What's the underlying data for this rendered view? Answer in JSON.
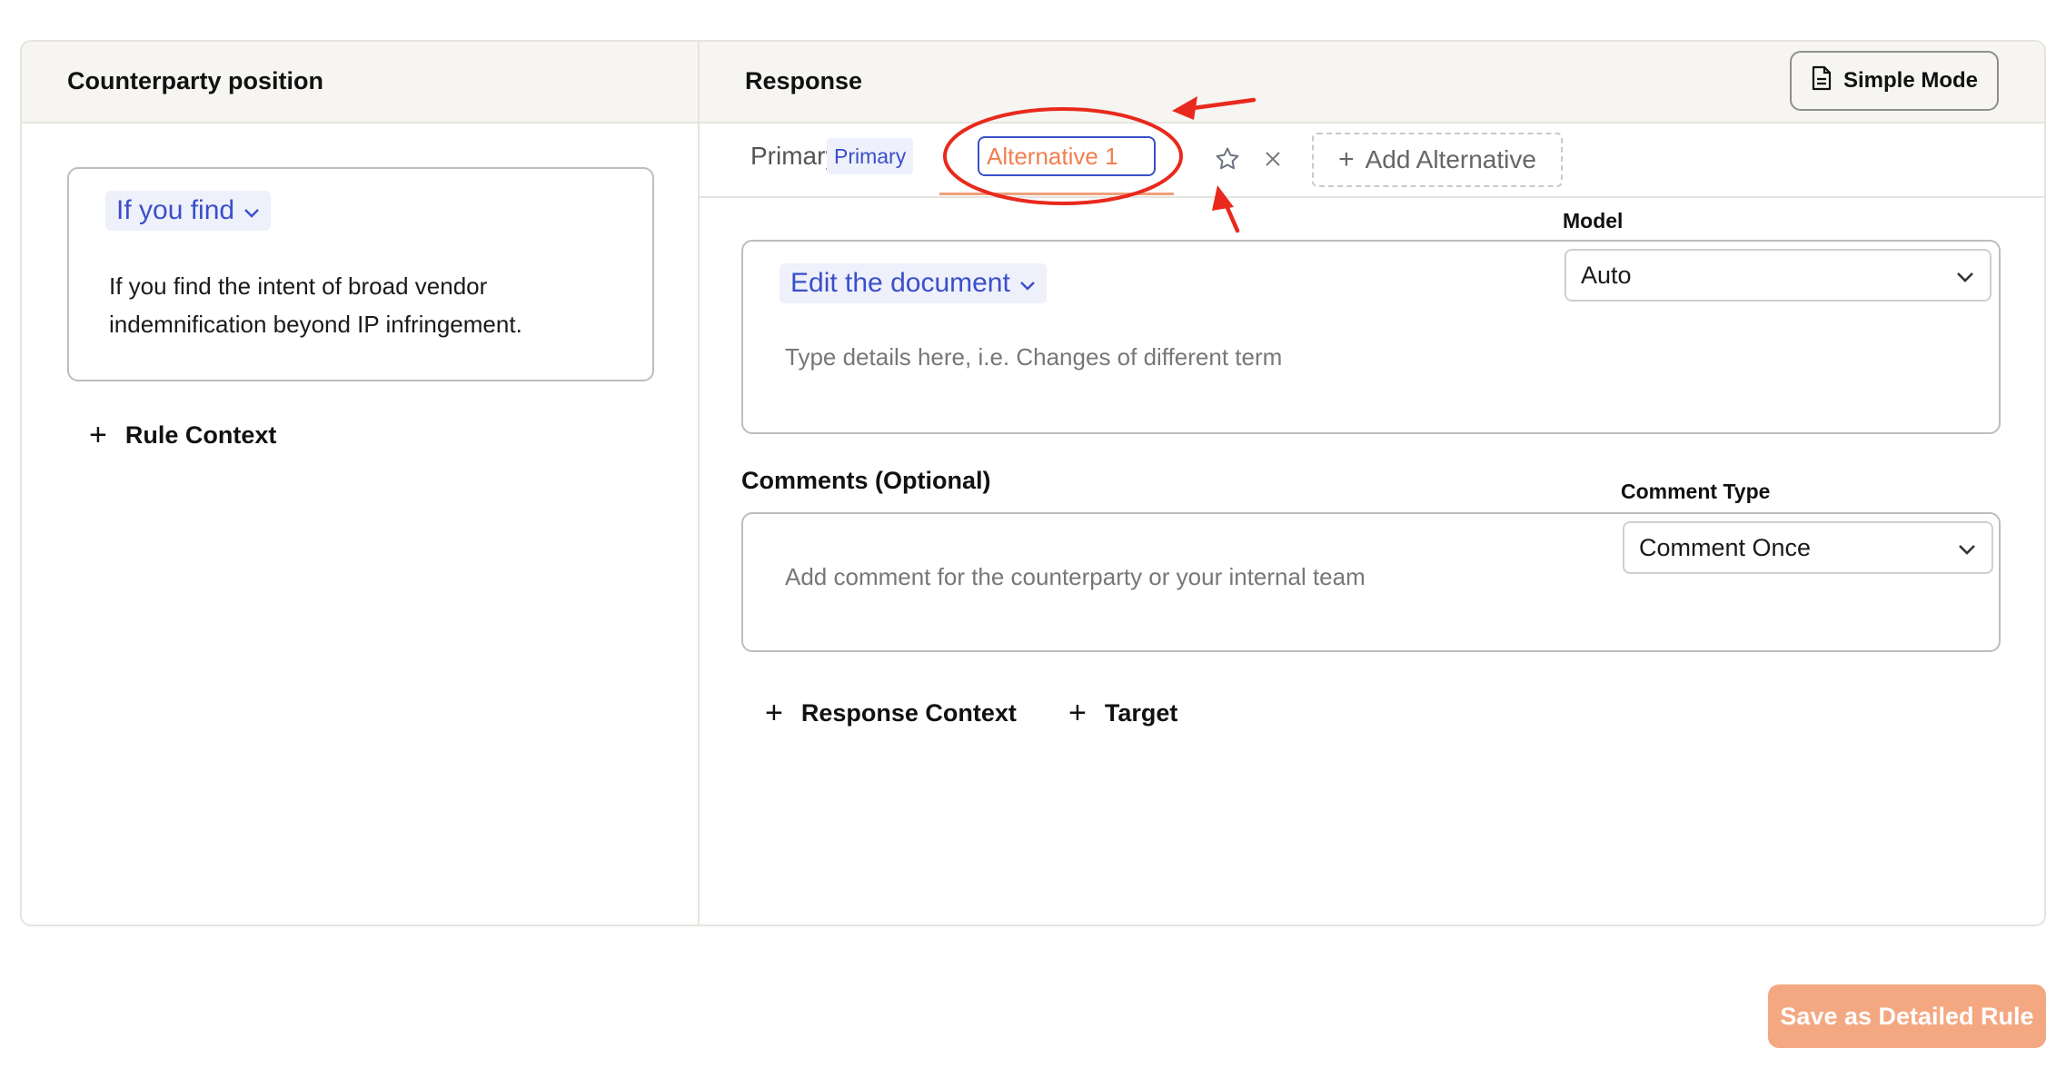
{
  "left_panel": {
    "title": "Counterparty position",
    "condition_chip": "If you find",
    "condition_text": "If you find the intent of broad vendor indemnification beyond IP infringement.",
    "rule_context_label": "Rule Context"
  },
  "right_panel": {
    "title": "Response",
    "simple_mode_label": "Simple Mode",
    "tabs": {
      "primary_label": "Primary",
      "primary_badge": "Primary",
      "alternative_value": "Alternative 1",
      "add_alternative_label": "Add Alternative"
    },
    "response": {
      "action_chip": "Edit the document",
      "placeholder": "Type details here, i.e. Changes of different term",
      "model_label": "Model",
      "model_value": "Auto"
    },
    "comments": {
      "heading": "Comments (Optional)",
      "placeholder": "Add comment for the counterparty or your internal team",
      "comment_type_label": "Comment Type",
      "comment_type_value": "Comment Once"
    },
    "response_context_label": "Response Context",
    "target_label": "Target"
  },
  "footer": {
    "save_label": "Save as Detailed Rule"
  },
  "colors": {
    "accent_blue": "#3b4fc8",
    "chip_bg": "#eef0fb",
    "alt_orange": "#f08050",
    "save_button": "#f4a882",
    "annotation_red": "#e8291c"
  }
}
